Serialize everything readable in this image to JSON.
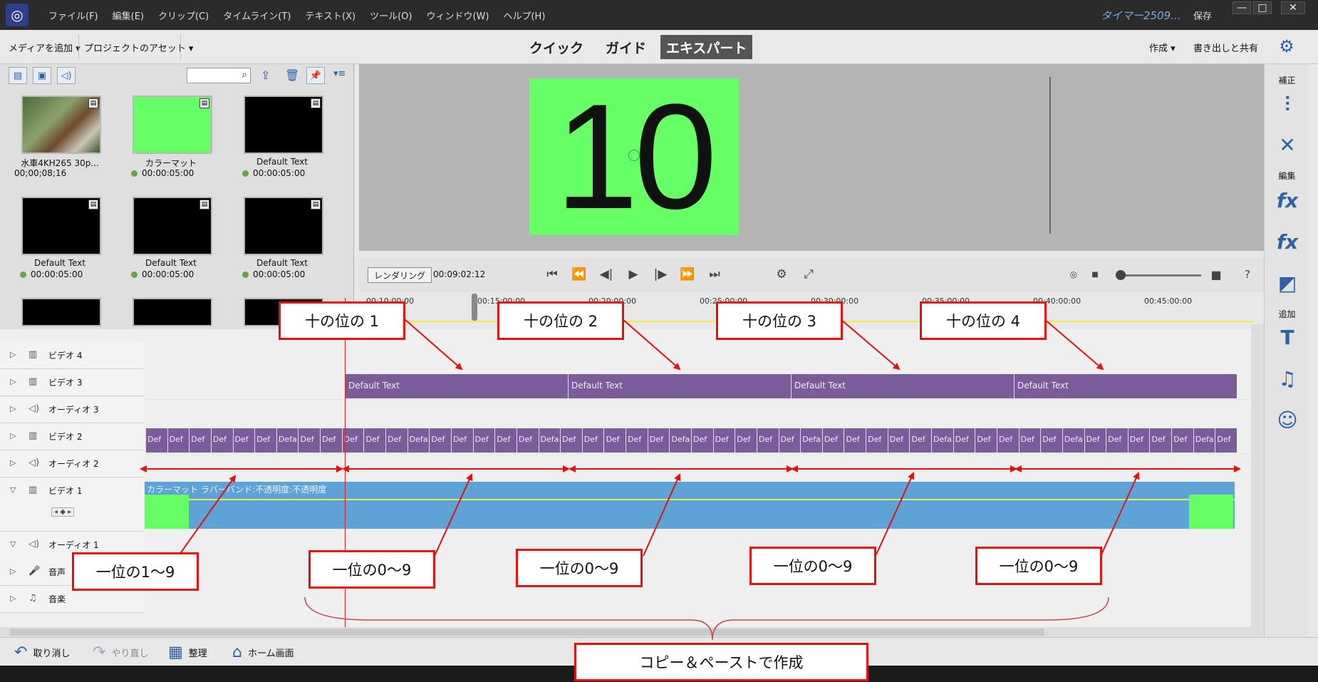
{
  "app": {
    "menus": [
      "ファイル(F)",
      "編集(E)",
      "クリップ(C)",
      "タイムライン(T)",
      "テキスト(X)",
      "ツール(O)",
      "ウィンドウ(W)",
      "ヘルプ(H)"
    ],
    "project_name": "タイマー2509...",
    "save_label": "保存"
  },
  "toolbar": {
    "add_media": "メディアを追加",
    "project_assets": "プロジェクトのアセット",
    "modes": [
      "クイック",
      "ガイド",
      "エキスパート"
    ],
    "active_mode": "エキスパート",
    "create": "作成",
    "export_share": "書き出しと共有"
  },
  "media": {
    "items": [
      {
        "name": "水車4KH265 30p...",
        "duration": "00;00;08;16",
        "kind": "video"
      },
      {
        "name": "カラーマット",
        "duration": "00:00:05:00",
        "kind": "green"
      },
      {
        "name": "Default Text",
        "duration": "00:00:05:00",
        "kind": "black"
      },
      {
        "name": "Default Text",
        "duration": "00:00:05:00",
        "kind": "black"
      },
      {
        "name": "Default Text",
        "duration": "00:00:05:00",
        "kind": "black"
      },
      {
        "name": "Default Text",
        "duration": "00:00:05:00",
        "kind": "black"
      }
    ]
  },
  "monitor": {
    "display_number": "10",
    "render_label": "レンダリング",
    "timecode": "00:09:02:12"
  },
  "ruler": {
    "labels": [
      "00:10:00:00",
      "00:15:00:00",
      "00:20:00:00",
      "00:25:00:00",
      "00:30:00:00",
      "00:35:00:00",
      "00:40:00:00",
      "00:45:00:00"
    ]
  },
  "tracks": [
    {
      "name": "ビデオ 4",
      "icon": "film-icon",
      "expanded": false
    },
    {
      "name": "ビデオ 3",
      "icon": "film-icon",
      "expanded": false
    },
    {
      "name": "オーディオ 3",
      "icon": "speaker-icon",
      "expanded": false
    },
    {
      "name": "ビデオ 2",
      "icon": "film-icon",
      "expanded": false
    },
    {
      "name": "オーディオ 2",
      "icon": "speaker-icon",
      "expanded": false
    },
    {
      "name": "ビデオ 1",
      "icon": "film-icon",
      "expanded": true
    },
    {
      "name": "オーディオ 1",
      "icon": "speaker-icon",
      "expanded": true
    },
    {
      "name": "音声",
      "icon": "mic-icon",
      "expanded": false
    },
    {
      "name": "音楽",
      "icon": "music-icon",
      "expanded": false
    }
  ],
  "clips": {
    "video3": [
      "Default Text",
      "Default Text",
      "Default Text",
      "Default Text"
    ],
    "video2_pattern": [
      "Def",
      "Def",
      "Def",
      "Def",
      "Def",
      "Def",
      "Defa",
      "Def",
      "Def",
      "Def",
      "Def",
      "Def",
      "Defa",
      "Def",
      "Def",
      "Def",
      "Def",
      "Def",
      "Defa",
      "Def",
      "Def",
      "Def",
      "Def",
      "Def",
      "Defa",
      "Def",
      "Def",
      "Def",
      "Def",
      "Def",
      "Defa",
      "Def",
      "Def",
      "Def",
      "Def",
      "Def",
      "Defa",
      "Def",
      "Def",
      "Def",
      "Def",
      "Def",
      "Defa",
      "Def",
      "Def",
      "Def",
      "Def",
      "Def",
      "Defa",
      "Def"
    ],
    "video1_title": "カラーマット ラバーバンド:不透明度:不透明度"
  },
  "right_panel": {
    "sections": [
      "補正",
      "編集",
      "追加"
    ]
  },
  "bottombar": {
    "undo": "取り消し",
    "redo": "やり直し",
    "organize": "整理",
    "home": "ホーム画面"
  },
  "annotations": {
    "tens": [
      "十の位の 1",
      "十の位の 2",
      "十の位の 3",
      "十の位の 4"
    ],
    "ones": [
      "一位の1〜9",
      "一位の0〜9",
      "一位の0〜9",
      "一位の0〜9",
      "一位の0〜9"
    ],
    "copy_paste": "コピー＆ペーストで作成"
  },
  "colors": {
    "green_matte": "#66ff66",
    "clip_purple": "#7a5c9b",
    "clip_blue": "#5ea3d6",
    "annotation_red": "#e31010"
  }
}
